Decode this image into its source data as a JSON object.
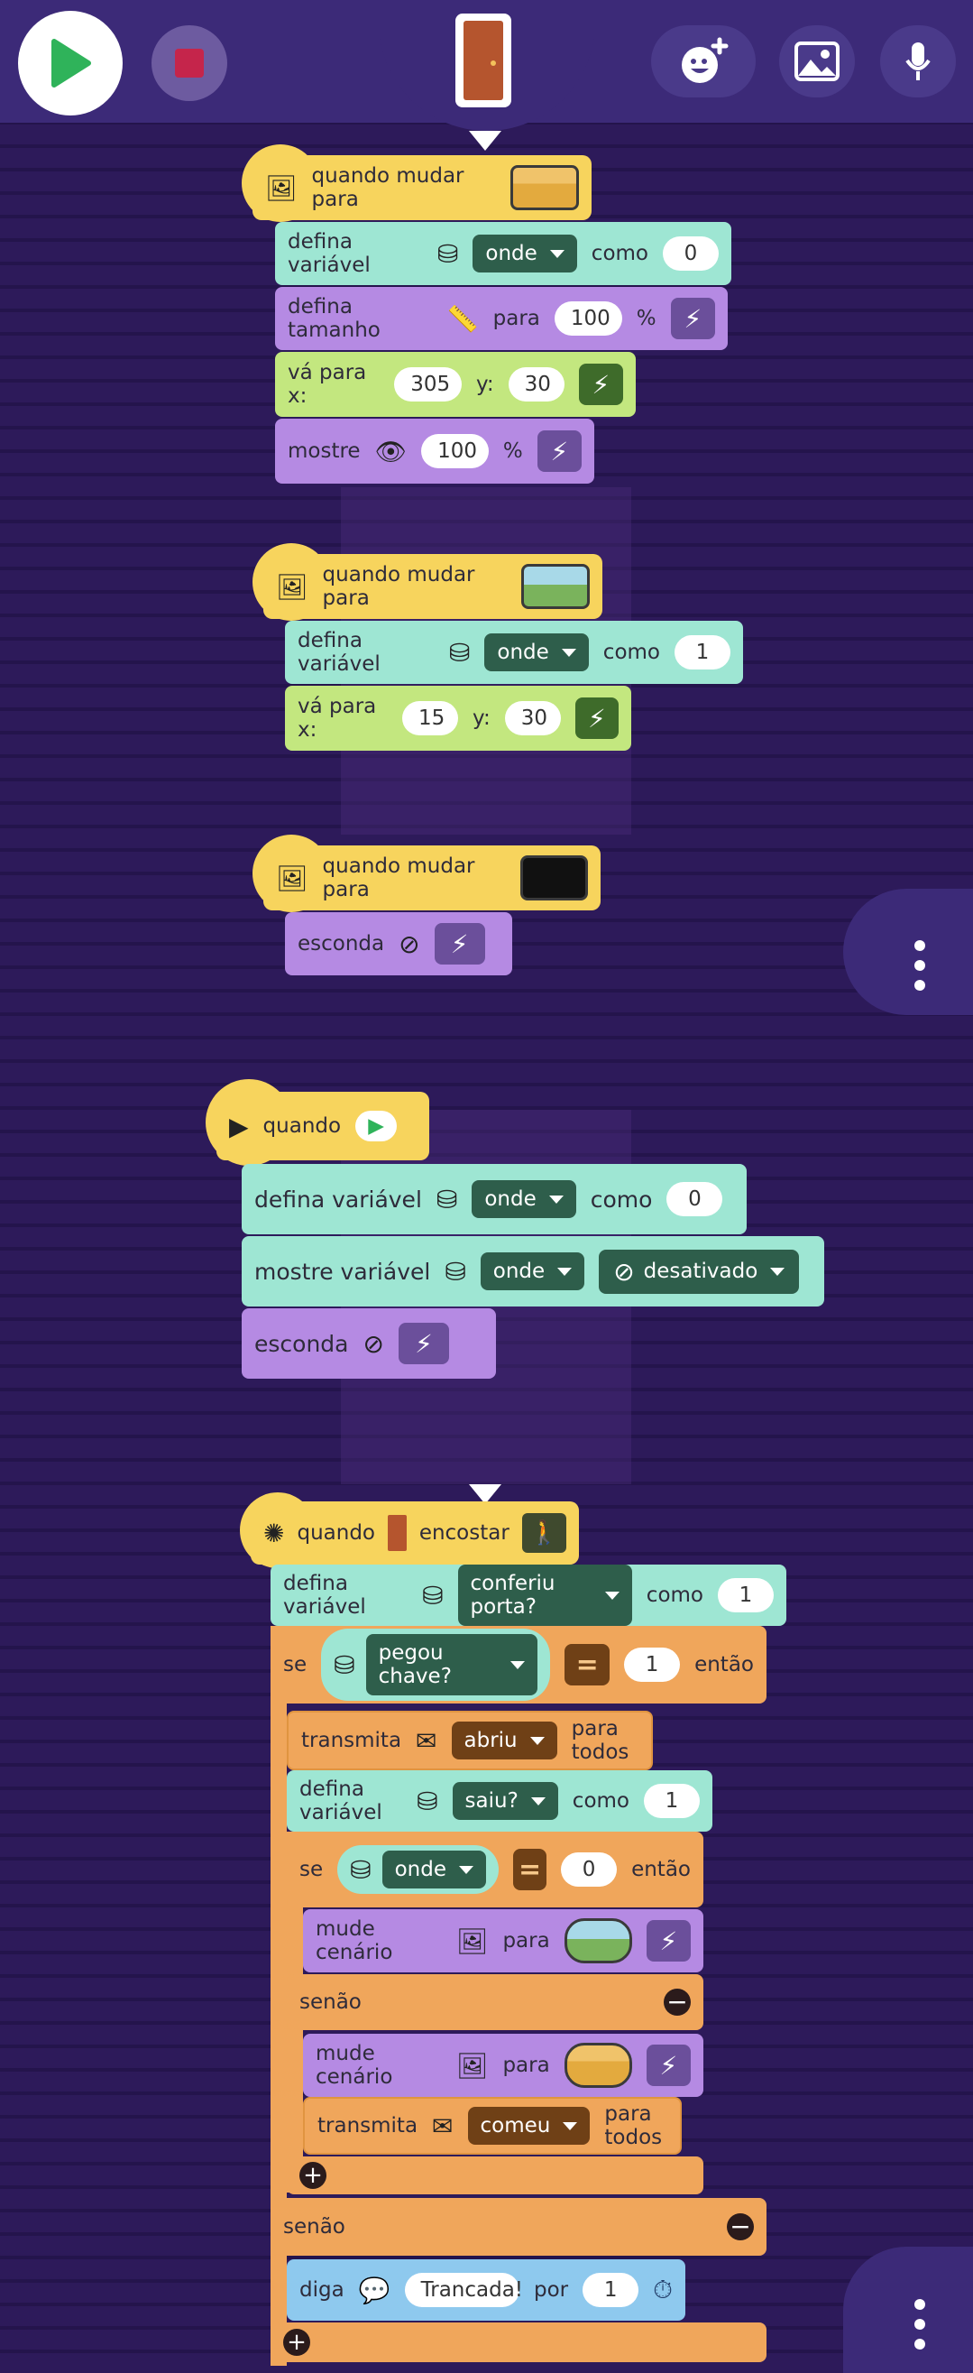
{
  "toolbar": {
    "play_icon": "play-icon",
    "stop_icon": "stop-icon",
    "sprite_icon": "door-sprite-icon",
    "add_sprite_icon": "add-sprite-icon",
    "background_icon": "image-icon",
    "mic_icon": "mic-icon"
  },
  "scripts": {
    "s1": {
      "hat": "quando mudar para",
      "set_var": {
        "label": "defina variável",
        "var": "onde",
        "como": "como",
        "value": "0"
      },
      "set_size": {
        "label": "defina tamanho",
        "para": "para",
        "value": "100",
        "unit": "%"
      },
      "go_to": {
        "label": "vá para x:",
        "x": "305",
        "y_label": "y:",
        "y": "30"
      },
      "show": {
        "label": "mostre",
        "value": "100",
        "unit": "%"
      }
    },
    "s2": {
      "hat": "quando mudar para",
      "set_var": {
        "label": "defina variável",
        "var": "onde",
        "como": "como",
        "value": "1"
      },
      "go_to": {
        "label": "vá para x:",
        "x": "15",
        "y_label": "y:",
        "y": "30"
      }
    },
    "s3": {
      "hat": "quando mudar para",
      "hide": "esconda"
    },
    "s4": {
      "hat": "quando",
      "set_var": {
        "label": "defina variável",
        "var": "onde",
        "como": "como",
        "value": "0"
      },
      "show_var": {
        "label": "mostre variável",
        "var": "onde",
        "state": "desativado"
      },
      "hide": "esconda"
    },
    "s5": {
      "hat_when": "quando",
      "hat_touch": "encostar",
      "set_var": {
        "label": "defina variável",
        "var": "conferiu porta?",
        "como": "como",
        "value": "1"
      },
      "if1": {
        "se": "se",
        "var": "pegou chave?",
        "eq": "=",
        "value": "1",
        "entao": "então"
      },
      "broadcast1": {
        "label": "transmita",
        "msg": "abriu",
        "to": "para todos"
      },
      "set_var2": {
        "label": "defina variável",
        "var": "saiu?",
        "como": "como",
        "value": "1"
      },
      "if2": {
        "se": "se",
        "var": "onde",
        "eq": "=",
        "value": "0",
        "entao": "então"
      },
      "change_bg1": {
        "label": "mude cenário",
        "para": "para"
      },
      "else1": "senão",
      "change_bg2": {
        "label": "mude cenário",
        "para": "para"
      },
      "broadcast2": {
        "label": "transmita",
        "msg": "comeu",
        "to": "para todos"
      },
      "else2": "senão",
      "say": {
        "label": "diga",
        "text": "Trancada!",
        "por": "por",
        "value": "1"
      }
    }
  }
}
